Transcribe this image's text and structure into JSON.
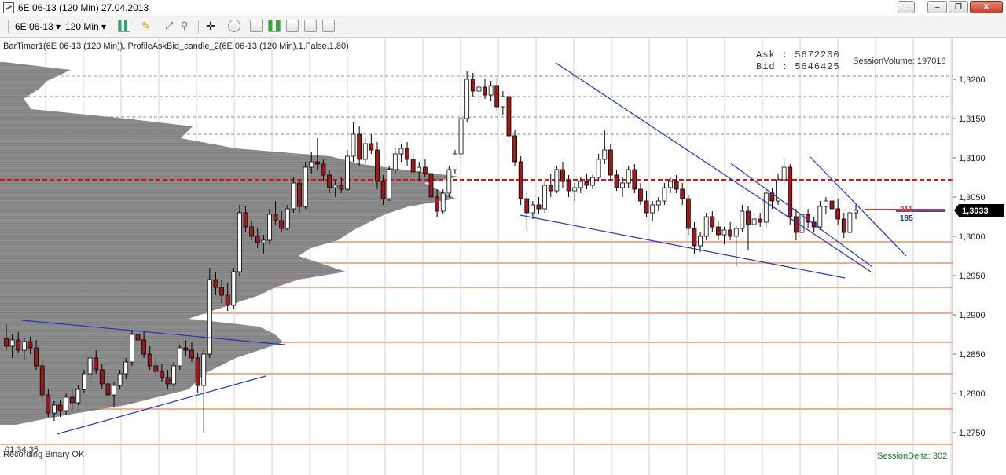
{
  "window": {
    "title": "6E 06-13 (120 Min)  27.04.2013",
    "btn_l": "L",
    "btn_min": "‒",
    "btn_max": "❐",
    "btn_close": "✕"
  },
  "toolbar": {
    "instrument": "6E 06-13",
    "interval": "120 Min",
    "dropdown_glyph": "▾"
  },
  "indicator_line": "BarTimer1(6E 06-13 (120 Min)), ProfileAskBid_candle_2(6E 06-13 (120 Min),1,False,1,80)",
  "ask_label": "Ask :",
  "ask_value": "5672200",
  "bid_label": "Bid :",
  "bid_value": "5646425",
  "session_volume": "SessionVolume: 197018",
  "session_delta": "SessionDelta: 302",
  "bar_timer": "01:34:35",
  "status": "Recording Binary OK",
  "marker_ask": "211",
  "marker_bid": "185",
  "last_price": "1,3033",
  "colors": {
    "up": "#ffffff",
    "down": "#9b1b1b",
    "profile": "#7a7a7a",
    "trendline": "#2233cc",
    "green_level": "#6e9e6e",
    "orange_level": "#f4a98a",
    "red_level": "#dd1111",
    "vgrid": "#cfcfcf"
  },
  "chart_data": {
    "type": "candlestick",
    "y_ticks": [
      "1,3200",
      "1,3150",
      "1,3100",
      "1,3050",
      "1,3000",
      "1,2950",
      "1,2900",
      "1,2850",
      "1,2800",
      "1,2750"
    ],
    "y_tick_values": [
      1.32,
      1.315,
      1.31,
      1.305,
      1.3,
      1.295,
      1.29,
      1.285,
      1.28,
      1.275
    ],
    "ylim": [
      1.2735,
      1.3243
    ],
    "last_price": 1.3033,
    "green_levels": [
      1.3204,
      1.3178,
      1.3152,
      1.313
    ],
    "red_level": 1.3072,
    "orange_levels": [
      1.2993,
      1.2966,
      1.2935,
      1.2902,
      1.2865,
      1.2825,
      1.278,
      1.2735
    ],
    "candles": [
      {
        "o": 1.287,
        "h": 1.2888,
        "l": 1.2855,
        "c": 1.286
      },
      {
        "o": 1.286,
        "h": 1.2875,
        "l": 1.2845,
        "c": 1.2868
      },
      {
        "o": 1.2868,
        "h": 1.2878,
        "l": 1.2852,
        "c": 1.2855
      },
      {
        "o": 1.2855,
        "h": 1.287,
        "l": 1.2843,
        "c": 1.2866
      },
      {
        "o": 1.2866,
        "h": 1.2872,
        "l": 1.285,
        "c": 1.2858
      },
      {
        "o": 1.2858,
        "h": 1.2868,
        "l": 1.283,
        "c": 1.2835
      },
      {
        "o": 1.2835,
        "h": 1.2842,
        "l": 1.279,
        "c": 1.2798
      },
      {
        "o": 1.2798,
        "h": 1.2805,
        "l": 1.277,
        "c": 1.2775
      },
      {
        "o": 1.2775,
        "h": 1.279,
        "l": 1.2765,
        "c": 1.2785
      },
      {
        "o": 1.2785,
        "h": 1.2792,
        "l": 1.277,
        "c": 1.2778
      },
      {
        "o": 1.2778,
        "h": 1.28,
        "l": 1.2772,
        "c": 1.2795
      },
      {
        "o": 1.2795,
        "h": 1.2805,
        "l": 1.278,
        "c": 1.2788
      },
      {
        "o": 1.2788,
        "h": 1.281,
        "l": 1.2785,
        "c": 1.2805
      },
      {
        "o": 1.2805,
        "h": 1.283,
        "l": 1.28,
        "c": 1.2825
      },
      {
        "o": 1.2825,
        "h": 1.285,
        "l": 1.2815,
        "c": 1.2845
      },
      {
        "o": 1.2845,
        "h": 1.2855,
        "l": 1.2825,
        "c": 1.283
      },
      {
        "o": 1.283,
        "h": 1.2838,
        "l": 1.2805,
        "c": 1.2812
      },
      {
        "o": 1.2812,
        "h": 1.2822,
        "l": 1.279,
        "c": 1.2798
      },
      {
        "o": 1.2798,
        "h": 1.2815,
        "l": 1.2782,
        "c": 1.281
      },
      {
        "o": 1.281,
        "h": 1.283,
        "l": 1.2805,
        "c": 1.2825
      },
      {
        "o": 1.2825,
        "h": 1.2845,
        "l": 1.2818,
        "c": 1.284
      },
      {
        "o": 1.284,
        "h": 1.288,
        "l": 1.2835,
        "c": 1.2875
      },
      {
        "o": 1.2875,
        "h": 1.2888,
        "l": 1.286,
        "c": 1.2868
      },
      {
        "o": 1.2868,
        "h": 1.288,
        "l": 1.2845,
        "c": 1.285
      },
      {
        "o": 1.285,
        "h": 1.286,
        "l": 1.283,
        "c": 1.2835
      },
      {
        "o": 1.2835,
        "h": 1.2845,
        "l": 1.2822,
        "c": 1.2828
      },
      {
        "o": 1.2828,
        "h": 1.2838,
        "l": 1.2815,
        "c": 1.282
      },
      {
        "o": 1.282,
        "h": 1.283,
        "l": 1.2805,
        "c": 1.2812
      },
      {
        "o": 1.2812,
        "h": 1.284,
        "l": 1.2808,
        "c": 1.2835
      },
      {
        "o": 1.2835,
        "h": 1.2862,
        "l": 1.283,
        "c": 1.2858
      },
      {
        "o": 1.2858,
        "h": 1.2868,
        "l": 1.2848,
        "c": 1.2855
      },
      {
        "o": 1.2855,
        "h": 1.2865,
        "l": 1.284,
        "c": 1.2845
      },
      {
        "o": 1.2845,
        "h": 1.2852,
        "l": 1.28,
        "c": 1.281
      },
      {
        "o": 1.281,
        "h": 1.2858,
        "l": 1.275,
        "c": 1.285
      },
      {
        "o": 1.285,
        "h": 1.296,
        "l": 1.2845,
        "c": 1.2945
      },
      {
        "o": 1.2945,
        "h": 1.2955,
        "l": 1.2925,
        "c": 1.2935
      },
      {
        "o": 1.2935,
        "h": 1.2945,
        "l": 1.2915,
        "c": 1.2925
      },
      {
        "o": 1.2925,
        "h": 1.294,
        "l": 1.2905,
        "c": 1.2912
      },
      {
        "o": 1.2912,
        "h": 1.296,
        "l": 1.2908,
        "c": 1.2955
      },
      {
        "o": 1.2955,
        "h": 1.304,
        "l": 1.295,
        "c": 1.303
      },
      {
        "o": 1.303,
        "h": 1.3038,
        "l": 1.3005,
        "c": 1.3012
      },
      {
        "o": 1.3012,
        "h": 1.302,
        "l": 1.2995,
        "c": 1.3
      },
      {
        "o": 1.3,
        "h": 1.301,
        "l": 1.2985,
        "c": 1.2992
      },
      {
        "o": 1.2992,
        "h": 1.3002,
        "l": 1.2978,
        "c": 1.2995
      },
      {
        "o": 1.2995,
        "h": 1.3035,
        "l": 1.299,
        "c": 1.3028
      },
      {
        "o": 1.3028,
        "h": 1.3045,
        "l": 1.3015,
        "c": 1.302
      },
      {
        "o": 1.302,
        "h": 1.3032,
        "l": 1.3005,
        "c": 1.301
      },
      {
        "o": 1.301,
        "h": 1.304,
        "l": 1.3008,
        "c": 1.3035
      },
      {
        "o": 1.3035,
        "h": 1.3075,
        "l": 1.303,
        "c": 1.3068
      },
      {
        "o": 1.3068,
        "h": 1.3072,
        "l": 1.303,
        "c": 1.3038
      },
      {
        "o": 1.3038,
        "h": 1.3095,
        "l": 1.3035,
        "c": 1.3088
      },
      {
        "o": 1.3088,
        "h": 1.3108,
        "l": 1.308,
        "c": 1.3095
      },
      {
        "o": 1.3095,
        "h": 1.3125,
        "l": 1.3085,
        "c": 1.3092
      },
      {
        "o": 1.3092,
        "h": 1.3098,
        "l": 1.307,
        "c": 1.3078
      },
      {
        "o": 1.3078,
        "h": 1.3085,
        "l": 1.3055,
        "c": 1.3062
      },
      {
        "o": 1.3062,
        "h": 1.3072,
        "l": 1.305,
        "c": 1.3065
      },
      {
        "o": 1.3065,
        "h": 1.3075,
        "l": 1.3055,
        "c": 1.306
      },
      {
        "o": 1.306,
        "h": 1.311,
        "l": 1.3058,
        "c": 1.3102
      },
      {
        "o": 1.3102,
        "h": 1.3145,
        "l": 1.3095,
        "c": 1.313
      },
      {
        "o": 1.313,
        "h": 1.314,
        "l": 1.309,
        "c": 1.3098
      },
      {
        "o": 1.3098,
        "h": 1.3125,
        "l": 1.3092,
        "c": 1.3118
      },
      {
        "o": 1.3118,
        "h": 1.313,
        "l": 1.3105,
        "c": 1.311
      },
      {
        "o": 1.311,
        "h": 1.312,
        "l": 1.306,
        "c": 1.307
      },
      {
        "o": 1.307,
        "h": 1.3078,
        "l": 1.304,
        "c": 1.3048
      },
      {
        "o": 1.3048,
        "h": 1.309,
        "l": 1.3045,
        "c": 1.3085
      },
      {
        "o": 1.3085,
        "h": 1.3112,
        "l": 1.308,
        "c": 1.3105
      },
      {
        "o": 1.3105,
        "h": 1.3118,
        "l": 1.3095,
        "c": 1.3112
      },
      {
        "o": 1.3112,
        "h": 1.312,
        "l": 1.309,
        "c": 1.3098
      },
      {
        "o": 1.3098,
        "h": 1.3105,
        "l": 1.3075,
        "c": 1.3082
      },
      {
        "o": 1.3082,
        "h": 1.3095,
        "l": 1.307,
        "c": 1.3088
      },
      {
        "o": 1.3088,
        "h": 1.3098,
        "l": 1.3075,
        "c": 1.308
      },
      {
        "o": 1.308,
        "h": 1.3085,
        "l": 1.3045,
        "c": 1.305
      },
      {
        "o": 1.305,
        "h": 1.306,
        "l": 1.3025,
        "c": 1.3032
      },
      {
        "o": 1.3032,
        "h": 1.306,
        "l": 1.3028,
        "c": 1.3055
      },
      {
        "o": 1.3055,
        "h": 1.309,
        "l": 1.305,
        "c": 1.3085
      },
      {
        "o": 1.3085,
        "h": 1.311,
        "l": 1.308,
        "c": 1.3105
      },
      {
        "o": 1.3105,
        "h": 1.316,
        "l": 1.31,
        "c": 1.315
      },
      {
        "o": 1.315,
        "h": 1.321,
        "l": 1.3145,
        "c": 1.32
      },
      {
        "o": 1.32,
        "h": 1.3208,
        "l": 1.3178,
        "c": 1.3185
      },
      {
        "o": 1.3185,
        "h": 1.3195,
        "l": 1.317,
        "c": 1.319
      },
      {
        "o": 1.319,
        "h": 1.32,
        "l": 1.3175,
        "c": 1.318
      },
      {
        "o": 1.318,
        "h": 1.3198,
        "l": 1.3172,
        "c": 1.3192
      },
      {
        "o": 1.3192,
        "h": 1.32,
        "l": 1.316,
        "c": 1.3165
      },
      {
        "o": 1.3165,
        "h": 1.3185,
        "l": 1.3155,
        "c": 1.3178
      },
      {
        "o": 1.3178,
        "h": 1.3182,
        "l": 1.312,
        "c": 1.3128
      },
      {
        "o": 1.3128,
        "h": 1.3135,
        "l": 1.309,
        "c": 1.3095
      },
      {
        "o": 1.3095,
        "h": 1.3102,
        "l": 1.304,
        "c": 1.3048
      },
      {
        "o": 1.3048,
        "h": 1.3055,
        "l": 1.3008,
        "c": 1.303
      },
      {
        "o": 1.303,
        "h": 1.3045,
        "l": 1.3022,
        "c": 1.304
      },
      {
        "o": 1.304,
        "h": 1.305,
        "l": 1.3028,
        "c": 1.3035
      },
      {
        "o": 1.3035,
        "h": 1.307,
        "l": 1.303,
        "c": 1.3065
      },
      {
        "o": 1.3065,
        "h": 1.308,
        "l": 1.305,
        "c": 1.3058
      },
      {
        "o": 1.3058,
        "h": 1.309,
        "l": 1.3055,
        "c": 1.3085
      },
      {
        "o": 1.3085,
        "h": 1.3095,
        "l": 1.3062,
        "c": 1.307
      },
      {
        "o": 1.307,
        "h": 1.3078,
        "l": 1.305,
        "c": 1.3058
      },
      {
        "o": 1.3058,
        "h": 1.3068,
        "l": 1.3045,
        "c": 1.3062
      },
      {
        "o": 1.3062,
        "h": 1.3075,
        "l": 1.3055,
        "c": 1.307
      },
      {
        "o": 1.307,
        "h": 1.308,
        "l": 1.306,
        "c": 1.3065
      },
      {
        "o": 1.3065,
        "h": 1.3078,
        "l": 1.306,
        "c": 1.3075
      },
      {
        "o": 1.3075,
        "h": 1.3105,
        "l": 1.307,
        "c": 1.3098
      },
      {
        "o": 1.3098,
        "h": 1.3135,
        "l": 1.3092,
        "c": 1.311
      },
      {
        "o": 1.311,
        "h": 1.3118,
        "l": 1.307,
        "c": 1.3078
      },
      {
        "o": 1.3078,
        "h": 1.3085,
        "l": 1.3058,
        "c": 1.3062
      },
      {
        "o": 1.3062,
        "h": 1.3075,
        "l": 1.305,
        "c": 1.3068
      },
      {
        "o": 1.3068,
        "h": 1.309,
        "l": 1.3062,
        "c": 1.3085
      },
      {
        "o": 1.3085,
        "h": 1.3092,
        "l": 1.3055,
        "c": 1.306
      },
      {
        "o": 1.306,
        "h": 1.3068,
        "l": 1.304,
        "c": 1.3045
      },
      {
        "o": 1.3045,
        "h": 1.3058,
        "l": 1.3025,
        "c": 1.303
      },
      {
        "o": 1.303,
        "h": 1.3045,
        "l": 1.302,
        "c": 1.304
      },
      {
        "o": 1.304,
        "h": 1.305,
        "l": 1.3032,
        "c": 1.3045
      },
      {
        "o": 1.3045,
        "h": 1.3068,
        "l": 1.304,
        "c": 1.3062
      },
      {
        "o": 1.3062,
        "h": 1.3075,
        "l": 1.3055,
        "c": 1.307
      },
      {
        "o": 1.307,
        "h": 1.3078,
        "l": 1.3055,
        "c": 1.306
      },
      {
        "o": 1.306,
        "h": 1.3068,
        "l": 1.304,
        "c": 1.3048
      },
      {
        "o": 1.3048,
        "h": 1.3052,
        "l": 1.3002,
        "c": 1.301
      },
      {
        "o": 1.301,
        "h": 1.3018,
        "l": 1.2978,
        "c": 1.2988
      },
      {
        "o": 1.2988,
        "h": 1.3005,
        "l": 1.298,
        "c": 1.3
      },
      {
        "o": 1.3,
        "h": 1.303,
        "l": 1.2995,
        "c": 1.3025
      },
      {
        "o": 1.3025,
        "h": 1.3032,
        "l": 1.3005,
        "c": 1.3012
      },
      {
        "o": 1.3012,
        "h": 1.302,
        "l": 1.2995,
        "c": 1.3002
      },
      {
        "o": 1.3002,
        "h": 1.3012,
        "l": 1.299,
        "c": 1.3008
      },
      {
        "o": 1.3008,
        "h": 1.3018,
        "l": 1.2995,
        "c": 1.3
      },
      {
        "o": 1.3,
        "h": 1.3015,
        "l": 1.2962,
        "c": 1.301
      },
      {
        "o": 1.301,
        "h": 1.304,
        "l": 1.3005,
        "c": 1.3032
      },
      {
        "o": 1.3032,
        "h": 1.3038,
        "l": 1.2982,
        "c": 1.3015
      },
      {
        "o": 1.3015,
        "h": 1.3028,
        "l": 1.301,
        "c": 1.3022
      },
      {
        "o": 1.3022,
        "h": 1.303,
        "l": 1.3012,
        "c": 1.3018
      },
      {
        "o": 1.3018,
        "h": 1.306,
        "l": 1.3012,
        "c": 1.3055
      },
      {
        "o": 1.3055,
        "h": 1.3062,
        "l": 1.3035,
        "c": 1.3045
      },
      {
        "o": 1.3045,
        "h": 1.308,
        "l": 1.304,
        "c": 1.3072
      },
      {
        "o": 1.3072,
        "h": 1.3098,
        "l": 1.3065,
        "c": 1.3088
      },
      {
        "o": 1.3088,
        "h": 1.3092,
        "l": 1.3015,
        "c": 1.3025
      },
      {
        "o": 1.3025,
        "h": 1.3035,
        "l": 1.2995,
        "c": 1.3005
      },
      {
        "o": 1.3005,
        "h": 1.3032,
        "l": 1.3,
        "c": 1.3028
      },
      {
        "o": 1.3028,
        "h": 1.3035,
        "l": 1.301,
        "c": 1.3018
      },
      {
        "o": 1.3018,
        "h": 1.3025,
        "l": 1.3005,
        "c": 1.3012
      },
      {
        "o": 1.3012,
        "h": 1.3045,
        "l": 1.3008,
        "c": 1.3038
      },
      {
        "o": 1.3038,
        "h": 1.305,
        "l": 1.3028,
        "c": 1.3045
      },
      {
        "o": 1.3045,
        "h": 1.305,
        "l": 1.303,
        "c": 1.3035
      },
      {
        "o": 1.3035,
        "h": 1.3048,
        "l": 1.3015,
        "c": 1.3022
      },
      {
        "o": 1.3022,
        "h": 1.303,
        "l": 1.2998,
        "c": 1.3005
      },
      {
        "o": 1.3005,
        "h": 1.3035,
        "l": 1.3,
        "c": 1.303
      },
      {
        "o": 1.303,
        "h": 1.304,
        "l": 1.3022,
        "c": 1.3033
      }
    ],
    "profile_points": [
      [
        1.3222,
        5
      ],
      [
        1.3212,
        90
      ],
      [
        1.3198,
        60
      ],
      [
        1.3188,
        50
      ],
      [
        1.3175,
        30
      ],
      [
        1.3162,
        40
      ],
      [
        1.315,
        160
      ],
      [
        1.314,
        245
      ],
      [
        1.3125,
        230
      ],
      [
        1.3112,
        300
      ],
      [
        1.3102,
        420
      ],
      [
        1.3092,
        460
      ],
      [
        1.3084,
        520
      ],
      [
        1.3076,
        585
      ],
      [
        1.3068,
        540
      ],
      [
        1.3058,
        560
      ],
      [
        1.3048,
        580
      ],
      [
        1.3038,
        520
      ],
      [
        1.3028,
        490
      ],
      [
        1.3018,
        470
      ],
      [
        1.3008,
        450
      ],
      [
        1.2995,
        430
      ],
      [
        1.2985,
        395
      ],
      [
        1.2975,
        380
      ],
      [
        1.2965,
        410
      ],
      [
        1.2955,
        440
      ],
      [
        1.2945,
        380
      ],
      [
        1.2935,
        350
      ],
      [
        1.2925,
        330
      ],
      [
        1.2915,
        300
      ],
      [
        1.2905,
        270
      ],
      [
        1.2895,
        240
      ],
      [
        1.2885,
        330
      ],
      [
        1.2875,
        350
      ],
      [
        1.2865,
        360
      ],
      [
        1.2855,
        330
      ],
      [
        1.2845,
        300
      ],
      [
        1.2835,
        280
      ],
      [
        1.2825,
        260
      ],
      [
        1.2815,
        250
      ],
      [
        1.2805,
        240
      ],
      [
        1.2795,
        200
      ],
      [
        1.2785,
        160
      ],
      [
        1.2775,
        100
      ],
      [
        1.2768,
        60
      ],
      [
        1.276,
        20
      ]
    ]
  }
}
